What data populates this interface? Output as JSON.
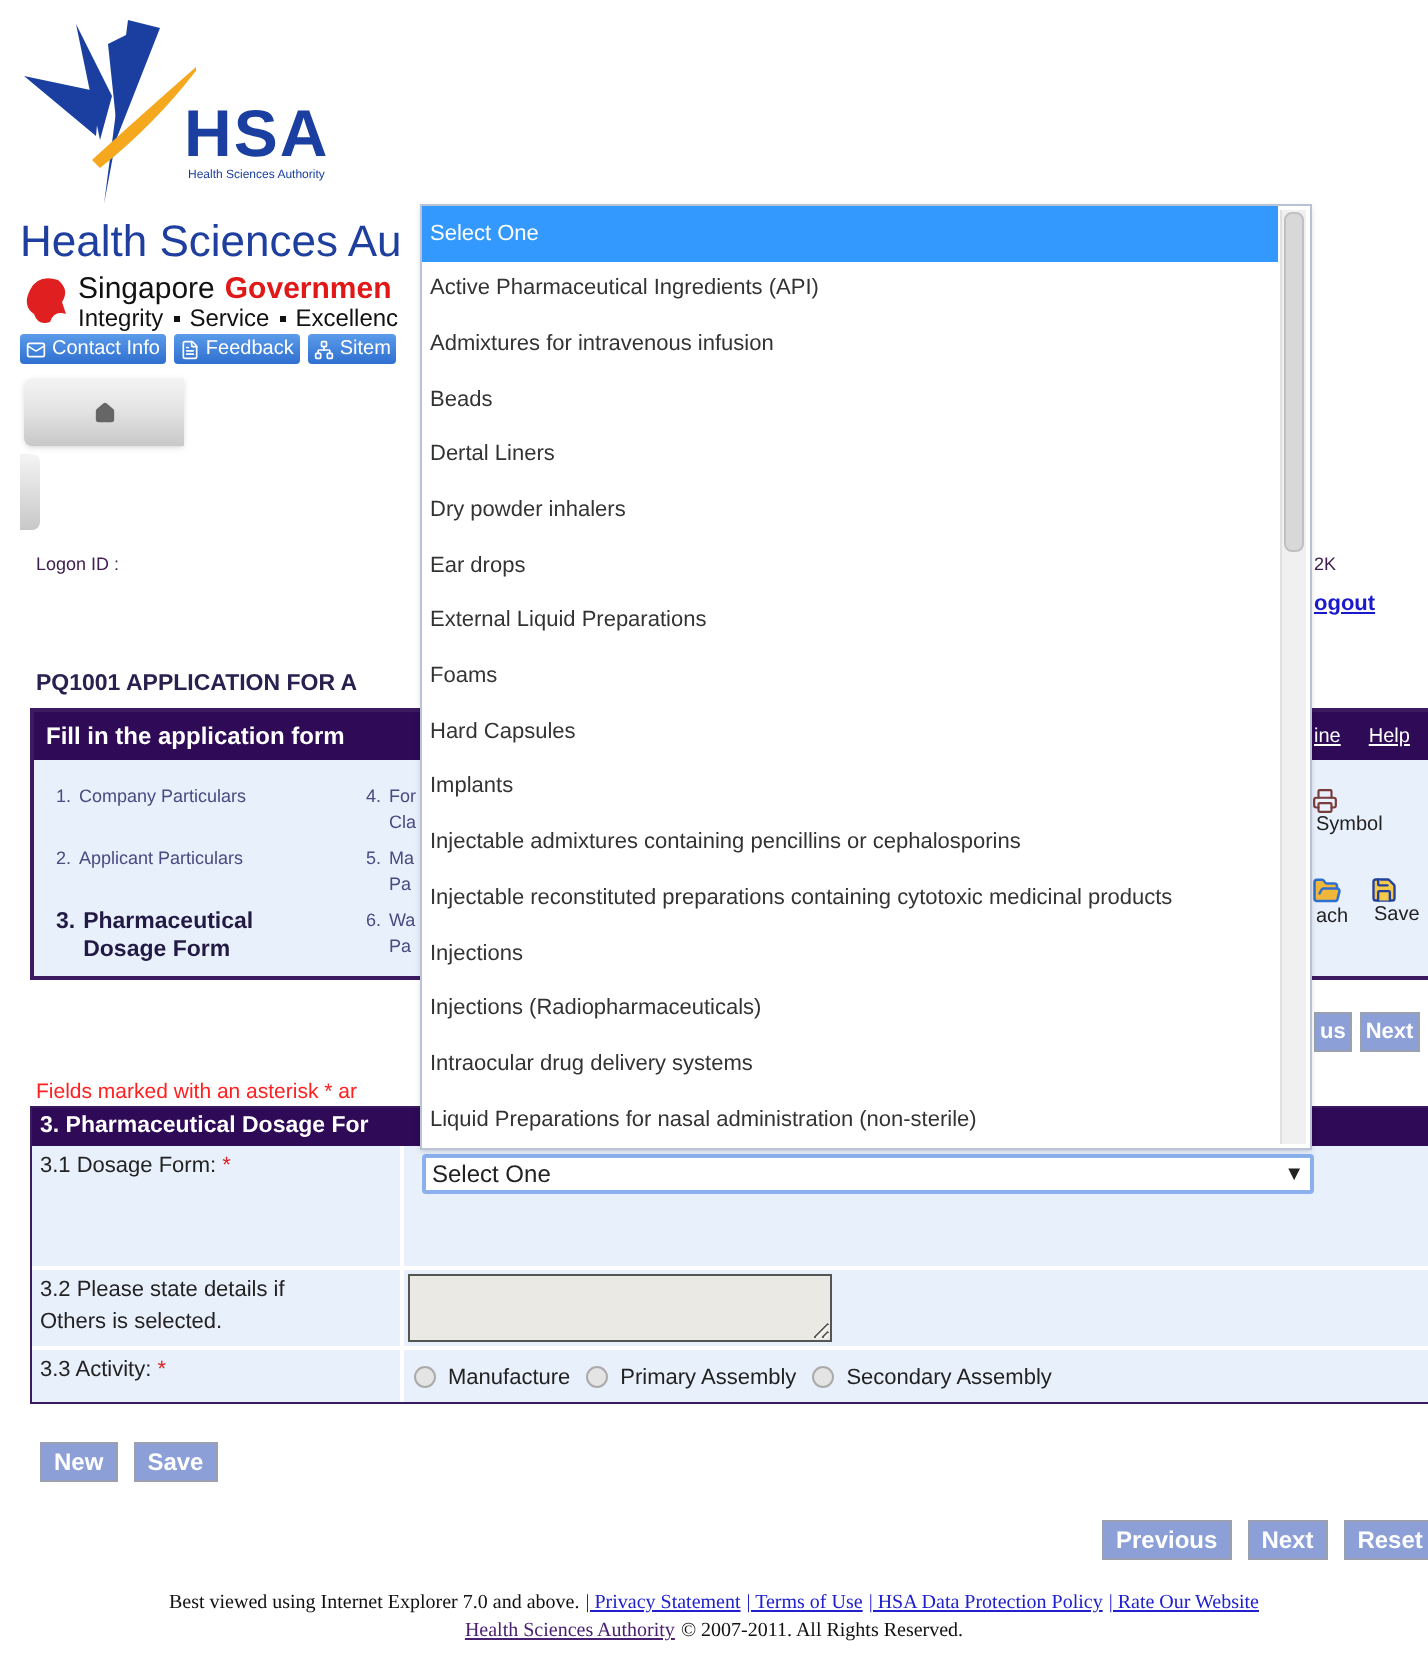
{
  "header": {
    "logo": {
      "acronym": "HSA",
      "name": "Health Sciences Authority"
    },
    "site_title": "Health Sciences Au",
    "gov": {
      "name": "Singapore",
      "name_highlight": "Governmen",
      "motto": [
        "Integrity",
        "Service",
        "Excellenc"
      ]
    },
    "links": [
      {
        "label": "Contact Info",
        "kind": "mail"
      },
      {
        "label": "Feedback",
        "kind": "doc"
      },
      {
        "label": "Sitem",
        "kind": "sitemap"
      }
    ]
  },
  "user": {
    "logon_label": "Logon ID :",
    "right_text": "2K",
    "logout": "ogout"
  },
  "page_title": "PQ1001 APPLICATION FOR A",
  "steps_panel": {
    "title": "Fill in the application form",
    "header_links": [
      "ine",
      "Help"
    ],
    "steps": [
      {
        "number": "1.",
        "lines": [
          "Company Particulars"
        ],
        "selected": false
      },
      {
        "number": "2.",
        "lines": [
          "Applicant Particulars"
        ],
        "selected": false
      },
      {
        "number": "3.",
        "lines": [
          "Pharmaceutical",
          "Dosage Form"
        ],
        "selected": true
      },
      {
        "number": "4.",
        "lines": [
          "For",
          "Cla"
        ],
        "selected": false
      },
      {
        "number": "5.",
        "lines": [
          "Ma",
          "Pa"
        ],
        "selected": false
      },
      {
        "number": "6.",
        "lines": [
          "Wa",
          "Pa"
        ],
        "selected": false
      }
    ],
    "tools": [
      {
        "label": "Symbol",
        "kind": "symbol"
      },
      {
        "label": "ach",
        "kind": "attach"
      },
      {
        "label": "Save",
        "kind": "save"
      }
    ]
  },
  "top_nav_buttons": [
    "us",
    "Next"
  ],
  "required_note": "Fields marked with an asterisk * ar",
  "section": {
    "title": "3. Pharmaceutical Dosage For",
    "rows": [
      {
        "kind": "select",
        "label": "3.1 Dosage Form:",
        "mark": "*",
        "value": "Select One",
        "arrow": "▼",
        "open_list": [
          {
            "label": "Select One",
            "selected": true
          },
          {
            "label": "Active Pharmaceutical Ingredients (API)",
            "selected": false
          },
          {
            "label": "Admixtures for intravenous infusion",
            "selected": false
          },
          {
            "label": "Beads",
            "selected": false
          },
          {
            "label": "Dertal Liners",
            "selected": false
          },
          {
            "label": "Dry powder inhalers",
            "selected": false
          },
          {
            "label": "Ear drops",
            "selected": false
          },
          {
            "label": "External Liquid Preparations",
            "selected": false
          },
          {
            "label": "Foams",
            "selected": false
          },
          {
            "label": "Hard Capsules",
            "selected": false
          },
          {
            "label": "Implants",
            "selected": false
          },
          {
            "label": "Injectable admixtures containing pencillins or cephalosporins",
            "selected": false
          },
          {
            "label": "Injectable reconstituted preparations containing cytotoxic medicinal products",
            "selected": false
          },
          {
            "label": "Injections",
            "selected": false
          },
          {
            "label": "Injections (Radiopharmaceuticals)",
            "selected": false
          },
          {
            "label": "Intraocular drug delivery systems",
            "selected": false
          },
          {
            "label": "Liquid Preparations for nasal administration (non-sterile)",
            "selected": false
          }
        ]
      },
      {
        "kind": "textarea",
        "label": "3.2 Please state details if Others is selected."
      },
      {
        "kind": "radio",
        "label": "3.3 Activity:",
        "mark": "*",
        "options": [
          {
            "label": "Manufacture",
            "selected": false
          },
          {
            "label": "Primary Assembly",
            "selected": false
          },
          {
            "label": "Secondary Assembly",
            "selected": false
          }
        ]
      }
    ]
  },
  "form_buttons": [
    "New",
    "Save"
  ],
  "bottom_nav_buttons": [
    "Previous",
    "Next",
    "Reset"
  ],
  "footer": {
    "note": "Best viewed using Internet Explorer 7.0 and above.",
    "links": [
      "| Privacy Statement",
      "| Terms of Use",
      "| HSA Data Protection Policy",
      "| Rate Our Website"
    ],
    "owner": "Health Sciences Authority",
    "copyright": "© 2007-2011. All Rights Reserved."
  }
}
